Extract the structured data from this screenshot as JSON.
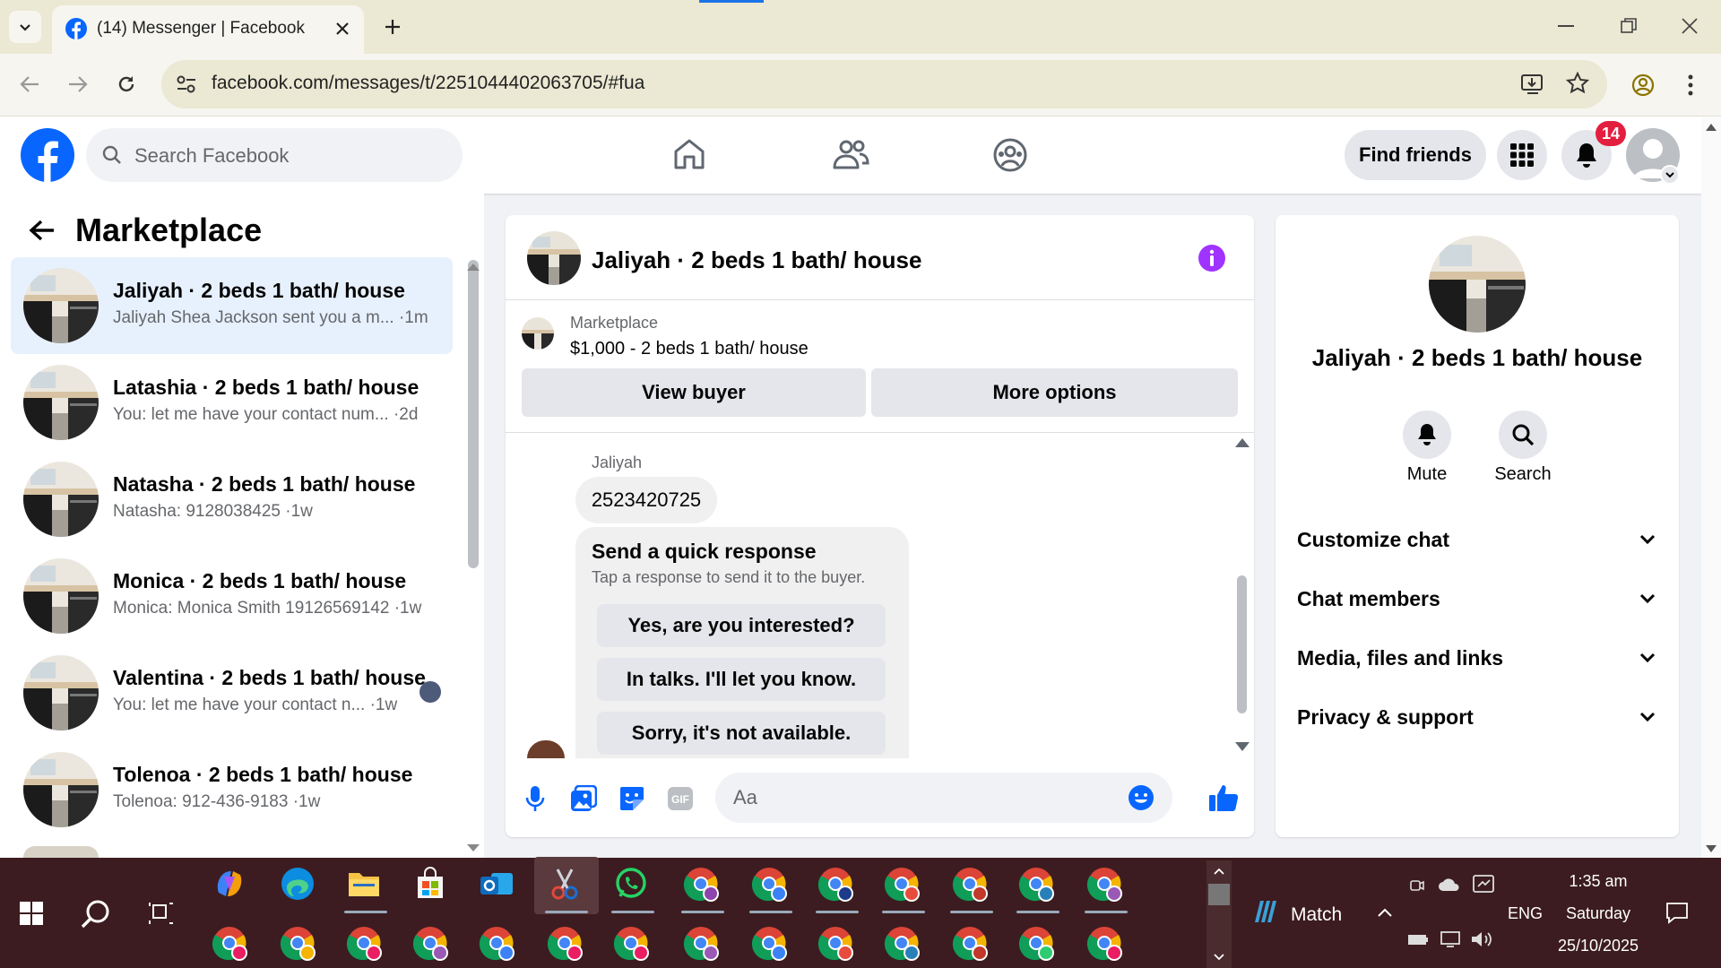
{
  "browser": {
    "tab_title": "(14) Messenger | Facebook",
    "url": "facebook.com/messages/t/2251044402063705/#fua"
  },
  "fb_header": {
    "search_placeholder": "Search Facebook",
    "find_friends": "Find friends",
    "notifications_count": "14"
  },
  "left": {
    "title": "Marketplace",
    "conversations": [
      {
        "name": "Jaliyah · 2 beds 1 bath/ house",
        "preview": "Jaliyah Shea Jackson sent you a m...",
        "time": "·1m",
        "selected": true
      },
      {
        "name": "Latashia · 2 beds 1 bath/ house",
        "preview": "You: let me have your contact num...",
        "time": "·2d"
      },
      {
        "name": "Natasha · 2 beds 1 bath/ house",
        "preview": "Natasha: 9128038425",
        "time": "·1w"
      },
      {
        "name": "Monica · 2 beds 1 bath/ house",
        "preview": "Monica: Monica Smith 19126569142",
        "time": "·1w"
      },
      {
        "name": "Valentina · 2 beds 1 bath/ house",
        "preview": "You: let me have your contact n...",
        "time": "·1w"
      },
      {
        "name": "Tolenoa · 2 beds 1 bath/ house",
        "preview": "Tolenoa: 912-436-9183",
        "time": "·1w"
      }
    ]
  },
  "chat": {
    "title": "Jaliyah · 2 beds 1 bath/ house",
    "listing_source": "Marketplace",
    "listing_title": "$1,000 - 2 beds 1 bath/ house",
    "view_buyer": "View buyer",
    "more_options": "More options",
    "sender": "Jaliyah",
    "message": "2523420725",
    "quick_title": "Send a quick response",
    "quick_sub": "Tap a response to send it to the buyer.",
    "quick_responses": [
      "Yes, are you interested?",
      "In talks. I'll let you know.",
      "Sorry, it's not available."
    ],
    "composer_placeholder": "Aa"
  },
  "info": {
    "name": "Jaliyah · 2 beds 1 bath/ house",
    "mute": "Mute",
    "search": "Search",
    "sections": [
      "Customize chat",
      "Chat members",
      "Media, files and links",
      "Privacy & support"
    ]
  },
  "taskbar": {
    "match": "Match",
    "lang": "ENG",
    "time": "1:35 am",
    "day": "Saturday",
    "date": "25/10/2025"
  },
  "colors": {
    "fb_blue": "#0866ff",
    "messenger_purple": "#a033ff",
    "badge_red": "#e41e3f",
    "selected_row": "#e7f1fe"
  }
}
